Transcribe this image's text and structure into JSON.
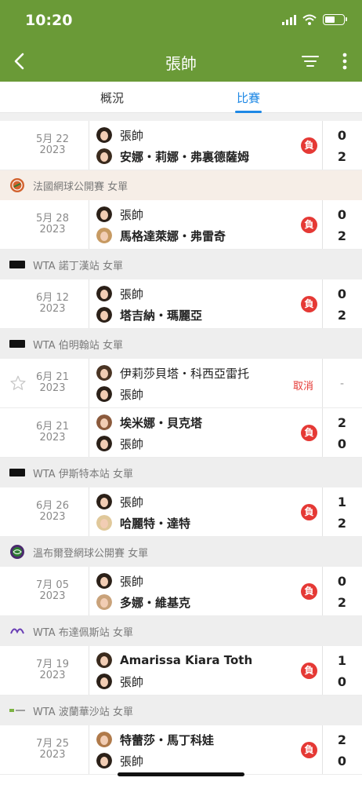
{
  "status_bar": {
    "time": "10:20"
  },
  "nav": {
    "title": "張帥"
  },
  "tabs": [
    {
      "label": "概況"
    },
    {
      "label": "比賽"
    }
  ],
  "sections": [
    {
      "tournament": "",
      "matches": [
        {
          "date": "5月 22",
          "year": "2023",
          "p1": "張帥",
          "p1_bold": false,
          "p2": "安娜・莉娜・弗裏德薩姆",
          "p2_bold": true,
          "result": "負",
          "s1": "0",
          "s2": "2"
        }
      ]
    },
    {
      "tournament": "法國網球公開賽 女單",
      "logo": "roland-garros",
      "matches": [
        {
          "date": "5月 28",
          "year": "2023",
          "p1": "張帥",
          "p1_bold": false,
          "p2": "馬格達萊娜・弗雷奇",
          "p2_bold": true,
          "result": "負",
          "s1": "0",
          "s2": "2"
        }
      ]
    },
    {
      "tournament": "WTA 諾丁漢站 女單",
      "logo": "wta-black",
      "matches": [
        {
          "date": "6月 12",
          "year": "2023",
          "p1": "張帥",
          "p1_bold": false,
          "p2": "塔吉納・瑪麗亞",
          "p2_bold": true,
          "result": "負",
          "s1": "0",
          "s2": "2"
        }
      ]
    },
    {
      "tournament": "WTA 伯明翰站 女單",
      "logo": "wta-black",
      "matches": [
        {
          "date": "6月 21",
          "year": "2023",
          "p1": "伊莉莎貝塔・科西亞雷托",
          "p1_bold": false,
          "p2": "張帥",
          "p2_bold": false,
          "result": "",
          "cancel": "取消",
          "s1": "-",
          "s2": "",
          "star": true
        },
        {
          "date": "6月 21",
          "year": "2023",
          "p1": "埃米娜・貝克塔",
          "p1_bold": true,
          "p2": "張帥",
          "p2_bold": false,
          "result": "負",
          "s1": "2",
          "s2": "0"
        }
      ]
    },
    {
      "tournament": "WTA 伊斯特本站 女單",
      "logo": "wta-black",
      "matches": [
        {
          "date": "6月 26",
          "year": "2023",
          "p1": "張帥",
          "p1_bold": false,
          "p2": "哈麗特・達特",
          "p2_bold": true,
          "result": "負",
          "s1": "1",
          "s2": "2"
        }
      ]
    },
    {
      "tournament": "溫布爾登網球公開賽 女單",
      "logo": "wimbledon",
      "matches": [
        {
          "date": "7月 05",
          "year": "2023",
          "p1": "張帥",
          "p1_bold": false,
          "p2": "多娜・維基克",
          "p2_bold": true,
          "result": "負",
          "s1": "0",
          "s2": "2"
        }
      ]
    },
    {
      "tournament": "WTA 布達佩斯站 女單",
      "logo": "wta-budapest",
      "matches": [
        {
          "date": "7月 19",
          "year": "2023",
          "p1": "Amarissa Kiara Toth",
          "p1_bold": true,
          "p2": "張帥",
          "p2_bold": false,
          "result": "負",
          "s1": "1",
          "s2": "0"
        }
      ]
    },
    {
      "tournament": "WTA 波蘭華沙站 女單",
      "logo": "wta-warsaw",
      "matches": [
        {
          "date": "7月 25",
          "year": "2023",
          "p1": "特蕾莎・馬丁科娃",
          "p1_bold": true,
          "p2": "張帥",
          "p2_bold": false,
          "result": "負",
          "s1": "2",
          "s2": "0"
        }
      ]
    }
  ],
  "colors": {
    "header_green": "#6a9a37",
    "accent_blue": "#1e88e5",
    "loss_red": "#e53935"
  }
}
